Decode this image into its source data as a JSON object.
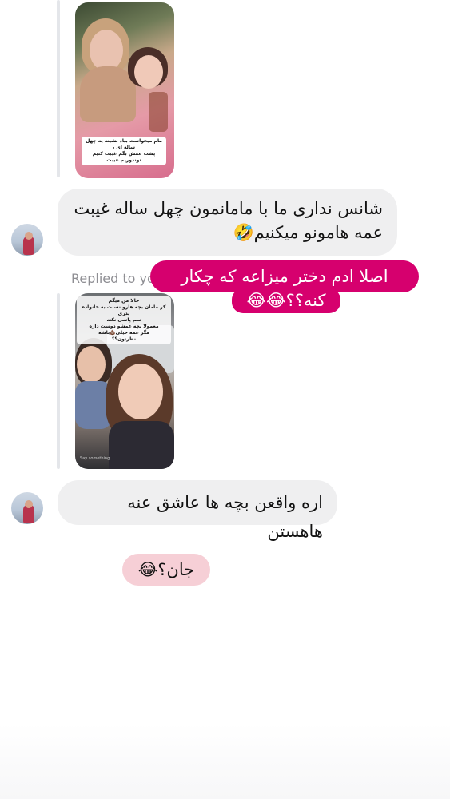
{
  "thread": {
    "story_reply_1": {
      "caption": "مام میخواست بیاد بشینه یه چهل ساله ای ،\nپشت عمش بگم غیبت کنیم\nتوندوریم غیبت"
    },
    "message_1": {
      "text": "شانس نداری ما با مامانمون چهل ساله غیبت عمه هامونو میکنیم🤣"
    },
    "replied_label": "Replied to yo",
    "pink_sticker": {
      "line1": "اصلا ادم دختر میزاعه که چکار",
      "line2": "کنه؟؟😂😂"
    },
    "story_reply_2": {
      "caption": "حالا من میگم\nکر مامان بچه هارو نسبت به خانواده پدری\nسم پاشی نکنه\nمعمولا بچه عمشو دوست داره\nمگر عمه خیلی💩باشه\nنظرتون؟؟",
      "watermark": "Say something..."
    },
    "message_2": {
      "text": "اره واقعن بچه ها عاشق عنه هاهستن"
    },
    "light_sticker": {
      "text": "جان؟😂"
    }
  }
}
